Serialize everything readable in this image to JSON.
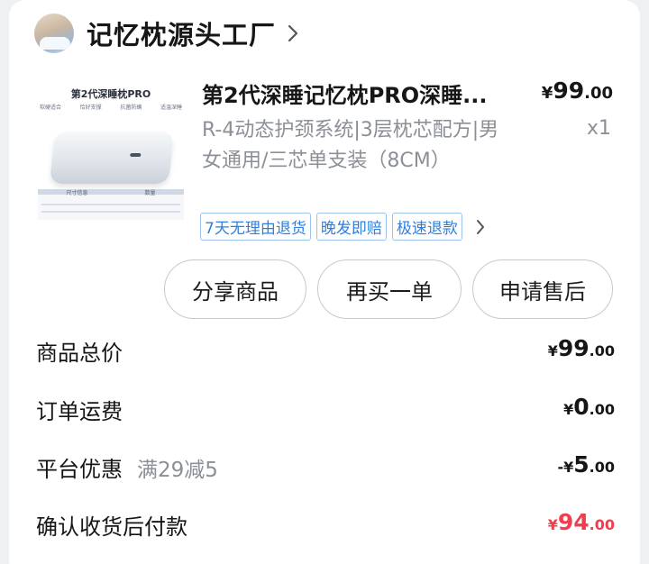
{
  "store": {
    "name": "记忆枕源头工厂"
  },
  "product": {
    "image": {
      "title": "第2代深睡枕PRO",
      "features": [
        "软硬适合",
        "恰好支撑",
        "抗菌防螨",
        "适温深睡"
      ],
      "table_headers": [
        "尺寸信息",
        "数量"
      ]
    },
    "title": "第2代深睡记忆枕PRO深睡...",
    "price": {
      "symbol": "¥",
      "int": "99",
      "dec": ".00"
    },
    "description": "R-4动态护颈系统|3层枕芯配方|男女通用/三芯单支装（8CM）",
    "quantity": "x1",
    "tags": [
      "7天无理由退货",
      "晚发即赔",
      "极速退款"
    ]
  },
  "actions": {
    "share": "分享商品",
    "rebuy": "再买一单",
    "after_sale": "申请售后"
  },
  "summary": {
    "total": {
      "label": "商品总价",
      "symbol": "¥",
      "int": "99",
      "dec": ".00"
    },
    "shipping": {
      "label": "订单运费",
      "symbol": "¥",
      "int": "0",
      "dec": ".00"
    },
    "discount": {
      "label": "平台优惠",
      "note": "满29减5",
      "symbol": "-¥",
      "int": "5",
      "dec": ".00"
    },
    "pay": {
      "label": "确认收货后付款",
      "symbol": "¥",
      "int": "94",
      "dec": ".00"
    }
  },
  "colors": {
    "accent_blue": "#2f7fe0",
    "price_red": "#f23d4f",
    "muted": "#8b8f96"
  },
  "icons": [
    "store-avatar",
    "chevron-right-icon"
  ]
}
